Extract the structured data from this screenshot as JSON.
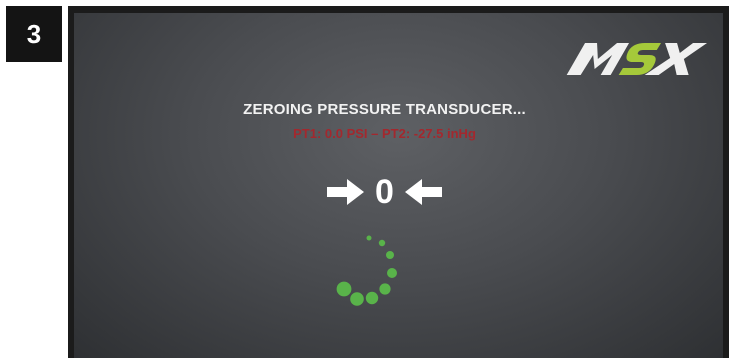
{
  "step": {
    "number": "3"
  },
  "brand": {
    "logo_text": "MSX",
    "logo_color_primary": "#f0f0f0",
    "logo_color_accent": "#a5c93a"
  },
  "screen": {
    "title": "ZEROING PRESSURE TRANSDUCER...",
    "readings": "PT1: 0.0 PSI – PT2: -27.5 inHg",
    "zero_value": "0",
    "icons": {
      "left_arrow": "arrow-right-icon",
      "right_arrow": "arrow-left-icon",
      "spinner": "loading-spinner-icon"
    },
    "colors": {
      "title": "#f2f2f2",
      "readings": "#a3282e",
      "spinner": "#59b34a",
      "background": "#4a4c50"
    }
  }
}
